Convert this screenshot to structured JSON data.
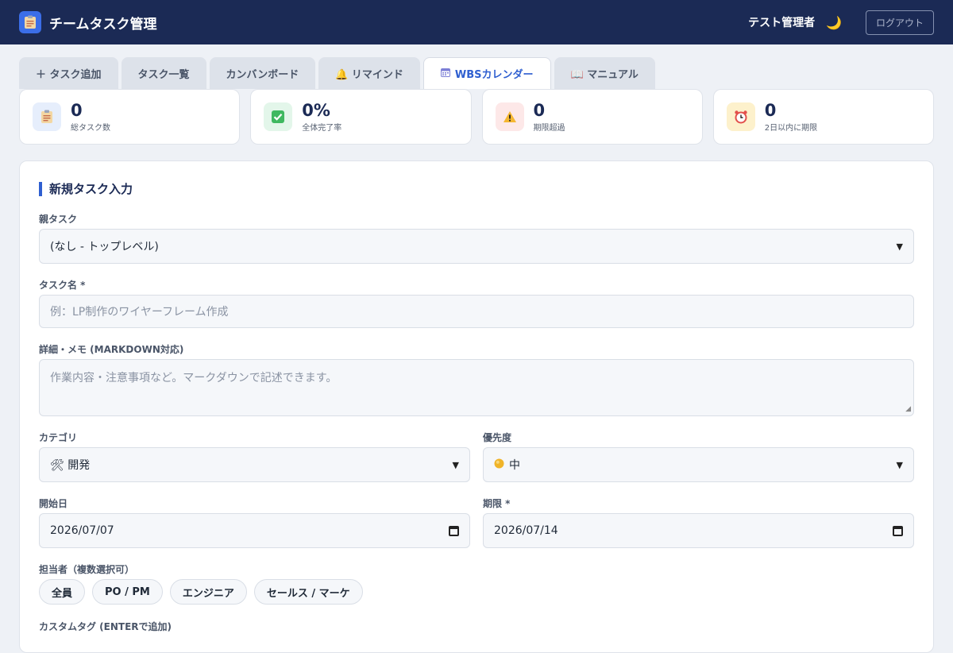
{
  "header": {
    "app_title": "チームタスク管理",
    "user_name": "テスト管理者",
    "logout_label": "ログアウト"
  },
  "tabs": [
    {
      "label": "＋ タスク追加",
      "active": false
    },
    {
      "label": "タスク一覧",
      "active": false
    },
    {
      "label": "カンバンボード",
      "active": false
    },
    {
      "label": "🔔 リマインド",
      "active": false
    },
    {
      "label": "WBSカレンダー",
      "active": true
    },
    {
      "label": "📖 マニュアル",
      "active": false
    }
  ],
  "stats": [
    {
      "value": "0",
      "label": "総タスク数",
      "icon": "clipboard-icon"
    },
    {
      "value": "0%",
      "label": "全体完了率",
      "icon": "checkmark-icon"
    },
    {
      "value": "0",
      "label": "期限超過",
      "icon": "warning-icon"
    },
    {
      "value": "0",
      "label": "2日以内に期限",
      "icon": "alarm-clock-icon"
    }
  ],
  "form": {
    "title": "新規タスク入力",
    "parent_task": {
      "label": "親タスク",
      "value": "(なし - トップレベル)"
    },
    "task_name": {
      "label": "タスク名 *",
      "placeholder": "例：LP制作のワイヤーフレーム作成"
    },
    "details": {
      "label": "詳細・メモ (MARKDOWN対応)",
      "placeholder": "作業内容・注意事項など。マークダウンで記述できます。"
    },
    "category": {
      "label": "カテゴリ",
      "value": "🛠 開発"
    },
    "priority": {
      "label": "優先度",
      "value": "中"
    },
    "start_date": {
      "label": "開始日",
      "value": "2026/07/07"
    },
    "due_date": {
      "label": "期限 *",
      "value": "2026/07/14"
    },
    "assignees": {
      "label": "担当者（複数選択可）",
      "options": [
        "全員",
        "PO / PM",
        "エンジニア",
        "セールス / マーケ"
      ]
    },
    "custom_tags": {
      "label": "カスタムタグ (ENTERで追加)"
    }
  },
  "colors": {
    "accent": "#2f5fd0",
    "header_bg": "#1b2a55"
  }
}
